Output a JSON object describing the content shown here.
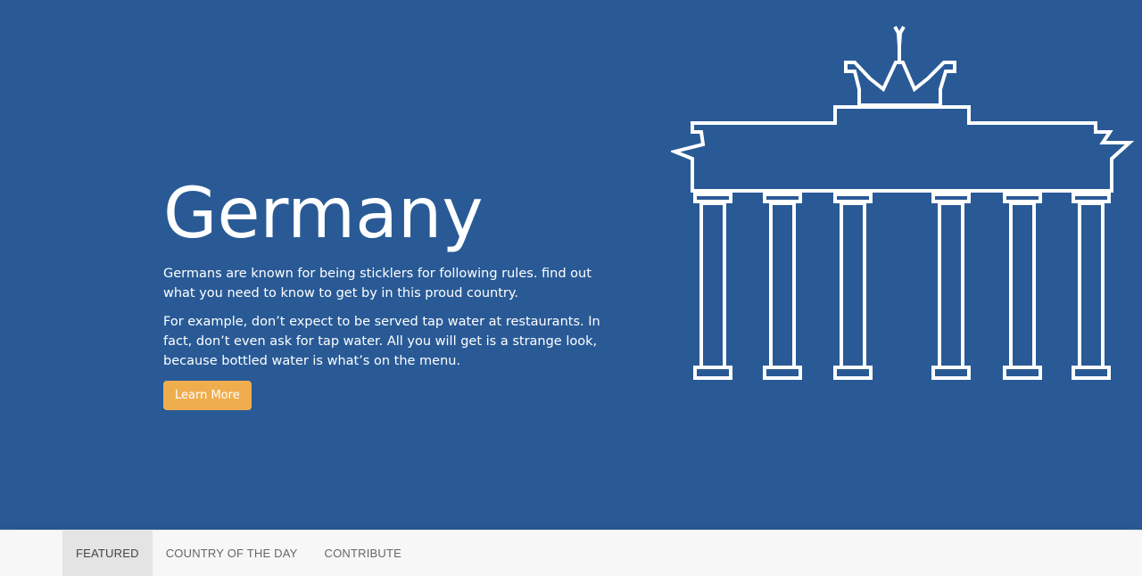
{
  "hero": {
    "title": "Germany",
    "paragraph_1": "Germans are known for being sticklers for following rules. find out what you need to know to get by in this proud country.",
    "paragraph_2": "For example, don’t expect to be served tap water at restaurants. In fact, don’t even ask for tap water. All you will get is a strange look, because bottled water is what’s on the menu.",
    "button_label": "Learn More",
    "image_icon": "brandenburg-gate-icon"
  },
  "nav": {
    "items": [
      {
        "label": "FEATURED",
        "active": true
      },
      {
        "label": "COUNTRY OF THE DAY",
        "active": false
      },
      {
        "label": "CONTRIBUTE",
        "active": false
      }
    ]
  },
  "colors": {
    "hero_background": "#295a96",
    "button": "#f0ad4e",
    "nav_background": "#f7f7f7",
    "nav_active": "#e4e4e4"
  }
}
